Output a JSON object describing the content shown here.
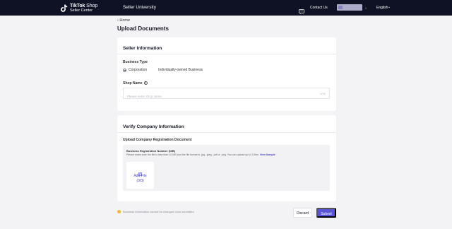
{
  "header": {
    "logo_line1_bold": "TikTok",
    "logo_line1_light": " Shop",
    "logo_line2": "Seller Center",
    "nav_item": "Seller University",
    "contact_label": "Contact Us",
    "language": "English"
  },
  "breadcrumb": "‹ Home",
  "page_title": "Upload Documents",
  "seller_info": {
    "title": "Seller Information",
    "business_type_label": "Business Type",
    "options": [
      "Corporation",
      "Individually-owned Business"
    ],
    "selected_option": "Corporation",
    "shop_name_label": "Shop Name",
    "shop_name_placeholder": "Please enter shop name",
    "shop_name_counter": "0/30"
  },
  "verify": {
    "title": "Verify Company Information",
    "upload_label": "Upload Company Registration Document",
    "doc_title": "Business Registration Number (NIB)",
    "doc_desc": "Please make sure the file is less than 10 MB and the file format is .jpg, .jpeg, .pdf or .png. You can upload up to 3 files.",
    "view_sample": "View Sample",
    "add_file_label": "Add File",
    "add_file_count": "(0/3)"
  },
  "footer": {
    "notice": "Business information cannot be changed once submitted.",
    "discard_label": "Discard",
    "submit_label": "Submit"
  },
  "colors": {
    "topbar": "#0f1224",
    "accent": "#5a55d6",
    "link": "#4b46c9",
    "warning": "#f2b63c"
  }
}
